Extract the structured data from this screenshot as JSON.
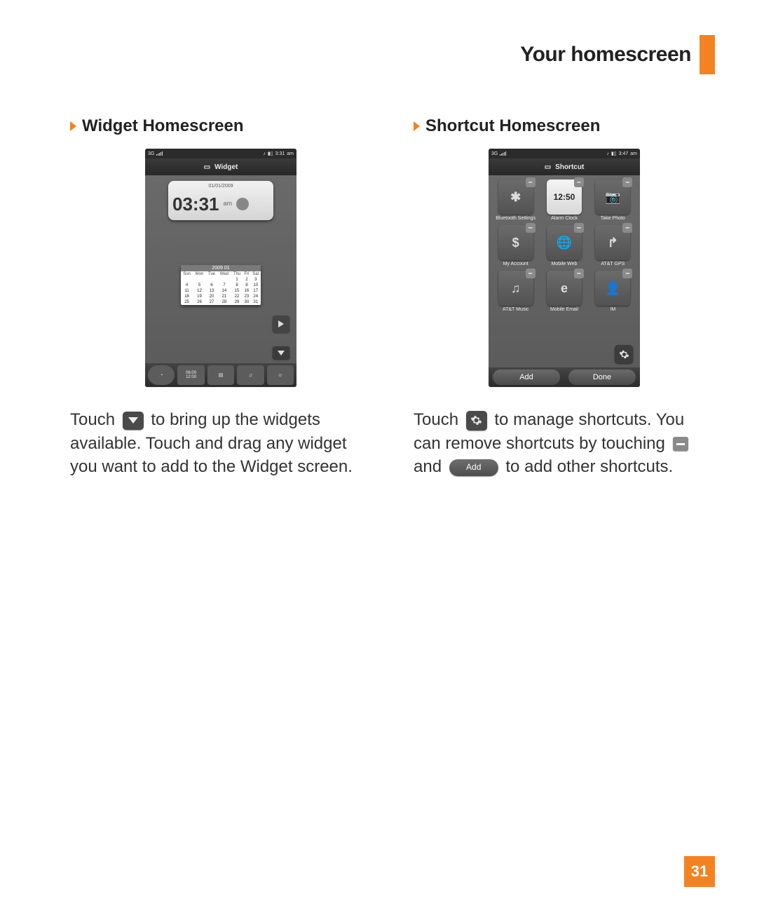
{
  "page": {
    "title": "Your homescreen",
    "number": "31"
  },
  "widget": {
    "heading": "Widget Homescreen",
    "statusbar": {
      "network": "3G",
      "time": "3:31",
      "ampm": "am"
    },
    "header_label": "Widget",
    "clock": {
      "date": "01/01/2009",
      "time": "03:31",
      "ampm": "am"
    },
    "calendar": {
      "title": "2009 01",
      "days": [
        "Sun",
        "Mon",
        "Tue",
        "Wed",
        "Thu",
        "Fri",
        "Sat"
      ],
      "rows": [
        [
          "",
          "",
          "",
          "",
          "1",
          "2",
          "3"
        ],
        [
          "4",
          "5",
          "6",
          "7",
          "8",
          "9",
          "10"
        ],
        [
          "11",
          "12",
          "13",
          "14",
          "15",
          "16",
          "17"
        ],
        [
          "18",
          "19",
          "20",
          "21",
          "22",
          "23",
          "24"
        ],
        [
          "25",
          "26",
          "27",
          "28",
          "29",
          "30",
          "31"
        ]
      ]
    },
    "dock_times": {
      "top": "06:00",
      "bottom": "12:00"
    },
    "copy": {
      "pre": "Touch ",
      "mid": " to bring up the widgets available. Touch and drag any widget you want to add to the Widget screen."
    }
  },
  "shortcut": {
    "heading": "Shortcut Homescreen",
    "statusbar": {
      "network": "3G",
      "time": "3:47",
      "ampm": "am"
    },
    "header_label": "Shortcut",
    "tiles": [
      {
        "glyph": "✱",
        "label": "Bluetooth Settings"
      },
      {
        "glyph": "12:50",
        "label": "Alarm Clock"
      },
      {
        "glyph": "📷",
        "label": "Take Photo"
      },
      {
        "glyph": "$",
        "label": "My Account"
      },
      {
        "glyph": "🌐",
        "label": "Mobile Web"
      },
      {
        "glyph": "↱",
        "label": "AT&T GPS"
      },
      {
        "glyph": "♫",
        "label": "AT&T Music"
      },
      {
        "glyph": "e",
        "label": "Mobile Email"
      },
      {
        "glyph": "👤",
        "label": "IM"
      }
    ],
    "buttons": {
      "add": "Add",
      "done": "Done"
    },
    "copy": {
      "t1": "Touch ",
      "t2": " to manage shortcuts. You can remove shortcuts by touching ",
      "t3": " and ",
      "t4": " to add other shortcuts.",
      "add_label": "Add"
    }
  }
}
